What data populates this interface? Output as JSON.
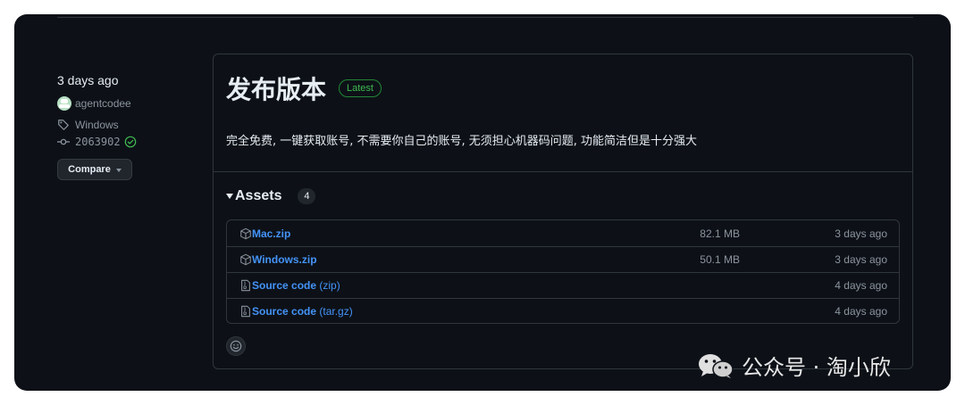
{
  "sidebar": {
    "date": "3 days ago",
    "author": "agentcodee",
    "tag": "Windows",
    "commit": "2063902",
    "compare_label": "Compare"
  },
  "release": {
    "title": "发布版本",
    "badge": "Latest",
    "body": "完全免费, 一键获取账号, 不需要你自己的账号, 无须担心机器码问题, 功能简洁但是十分强大"
  },
  "assets": {
    "title": "Assets",
    "count": "4",
    "items": [
      {
        "name": "Mac.zip",
        "suffix": "",
        "size": "82.1 MB",
        "date": "3 days ago",
        "icon": "package-icon"
      },
      {
        "name": "Windows.zip",
        "suffix": "",
        "size": "50.1 MB",
        "date": "3 days ago",
        "icon": "package-icon"
      },
      {
        "name": "Source code",
        "suffix": " (zip)",
        "size": "",
        "date": "4 days ago",
        "icon": "file-zip-icon"
      },
      {
        "name": "Source code",
        "suffix": " (tar.gz)",
        "size": "",
        "date": "4 days ago",
        "icon": "file-zip-icon"
      }
    ]
  },
  "watermark": "公众号 · 淘小欣",
  "colors": {
    "background": "#0d1117",
    "border": "#30363d",
    "link": "#4493f8",
    "muted": "#8b949e",
    "text": "#e6edf3",
    "success": "#3fb950"
  }
}
